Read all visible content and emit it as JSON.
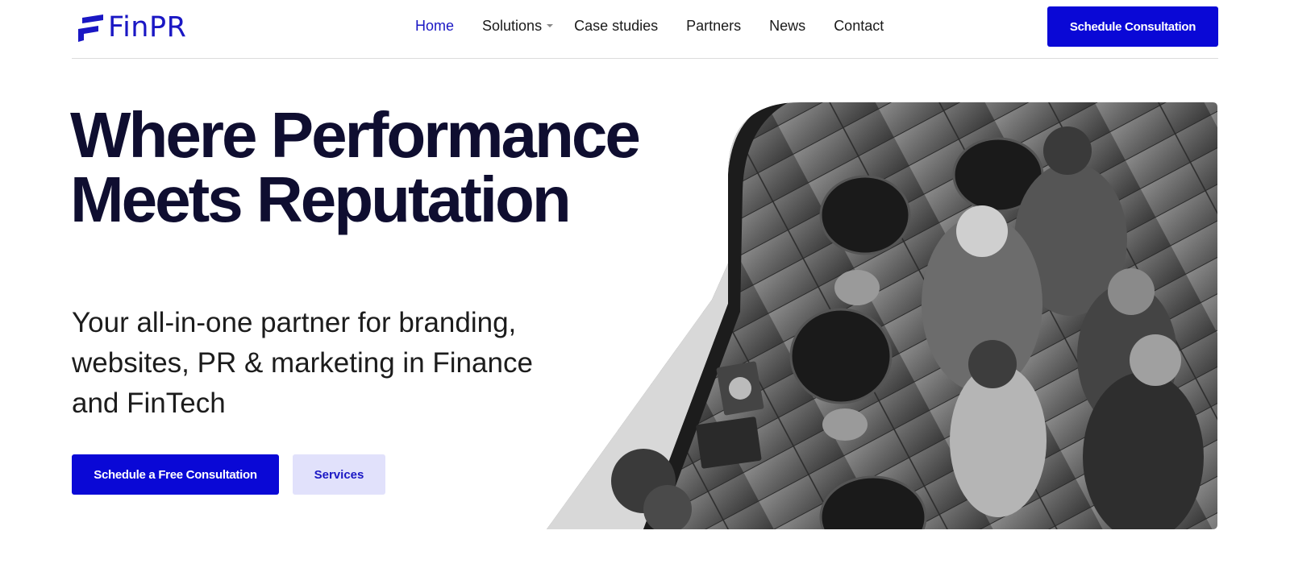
{
  "brand": {
    "name": "FinPR",
    "accent": "#0a08d6",
    "logo_icon": "finpr-logo-mark"
  },
  "nav": {
    "items": [
      {
        "label": "Home",
        "active": true
      },
      {
        "label": "Solutions",
        "has_dropdown": true
      },
      {
        "label": "Case studies"
      },
      {
        "label": "Partners"
      },
      {
        "label": "News"
      },
      {
        "label": "Contact"
      }
    ]
  },
  "header": {
    "cta_label": "Schedule Consultation"
  },
  "hero": {
    "headline_line1": "Where Performance",
    "headline_line2": "Meets Reputation",
    "subtext": "Your all-in-one partner for branding, websites, PR & marketing in Finance and FinTech",
    "primary_cta": "Schedule a Free Consultation",
    "secondary_cta": "Services",
    "image_icon": "team-office-photo"
  }
}
